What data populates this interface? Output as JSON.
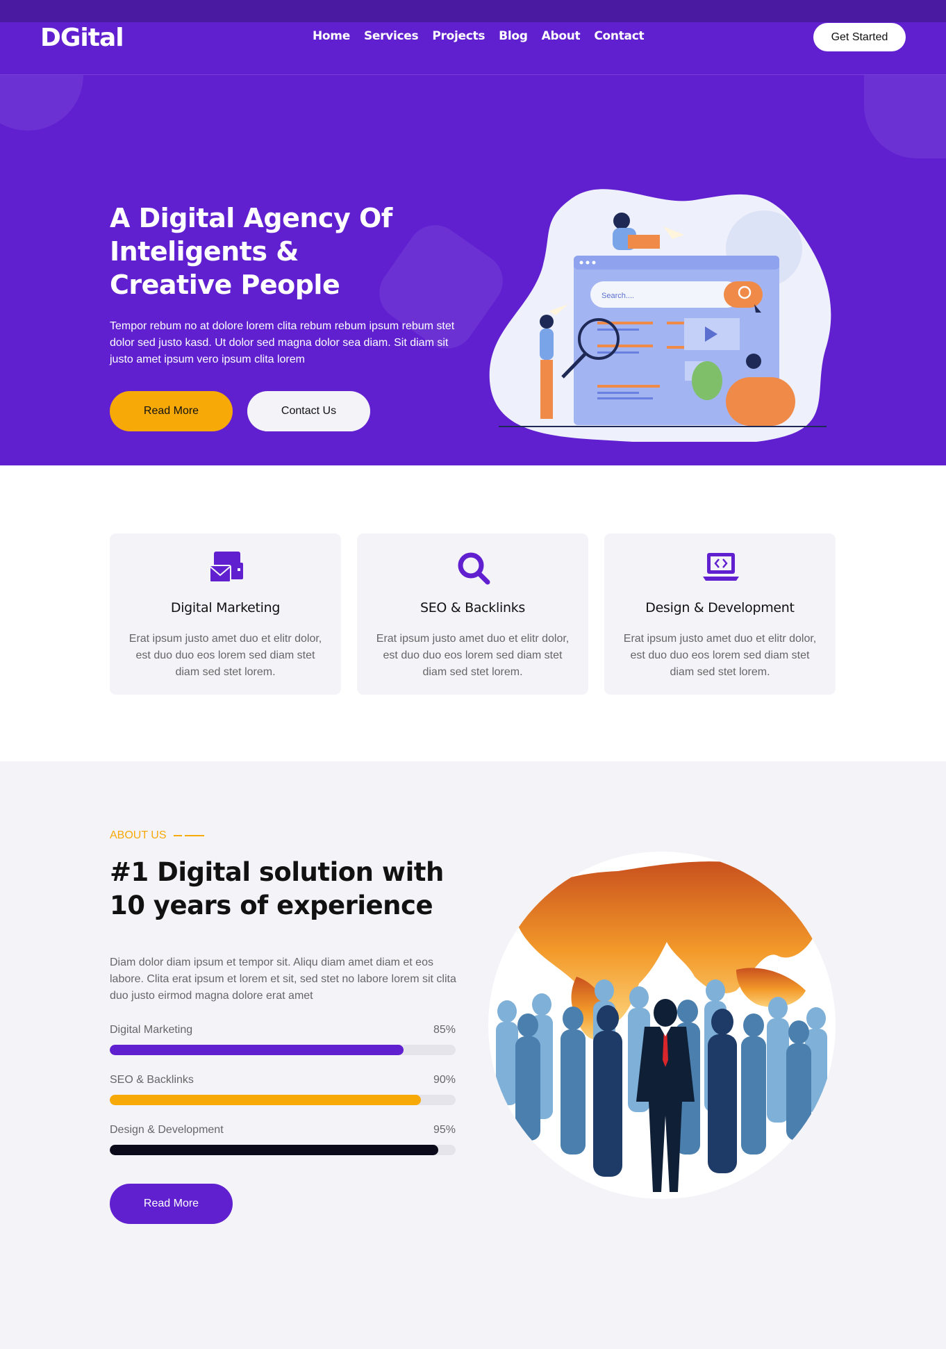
{
  "brand": {
    "logo": "DGital"
  },
  "nav": {
    "items": [
      "Home",
      "Services",
      "Projects",
      "Blog",
      "About",
      "Contact"
    ],
    "cta": "Get Started"
  },
  "hero": {
    "title": "A Digital Agency Of Inteligents & Creative People",
    "text": "Tempor rebum no at dolore lorem clita rebum rebum ipsum rebum stet dolor sed justo kasd. Ut dolor sed magna dolor sea diam. Sit diam sit justo amet ipsum vero ipsum clita lorem",
    "read_more": "Read More",
    "contact": "Contact Us",
    "search_placeholder": "Search...."
  },
  "services": [
    {
      "title": "Digital Marketing",
      "text": "Erat ipsum justo amet duo et elitr dolor, est duo duo eos lorem sed diam stet diam sed stet lorem.",
      "icon": "mail-icon"
    },
    {
      "title": "SEO & Backlinks",
      "text": "Erat ipsum justo amet duo et elitr dolor, est duo duo eos lorem sed diam stet diam sed stet lorem.",
      "icon": "search-icon"
    },
    {
      "title": "Design & Development",
      "text": "Erat ipsum justo amet duo et elitr dolor, est duo duo eos lorem sed diam stet diam sed stet lorem.",
      "icon": "laptop-code-icon"
    }
  ],
  "about": {
    "eyebrow": "ABOUT US",
    "title": "#1 Digital solution with 10 years of experience",
    "text": "Diam dolor diam ipsum et tempor sit. Aliqu diam amet diam et eos labore. Clita erat ipsum et lorem et sit, sed stet no labore lorem sit clita duo justo eirmod magna dolore erat amet",
    "skills": [
      {
        "label": "Digital Marketing",
        "value": "85%",
        "fraction": 0.85,
        "color": "#6020d0"
      },
      {
        "label": "SEO & Backlinks",
        "value": "90%",
        "fraction": 0.9,
        "color": "#f7a908"
      },
      {
        "label": "Design & Development",
        "value": "95%",
        "fraction": 0.95,
        "color": "#0a0a1a"
      }
    ],
    "read_more": "Read More"
  },
  "colors": {
    "primary": "#6020d0",
    "accent": "#f7a908",
    "light": "#f4f3f8"
  }
}
